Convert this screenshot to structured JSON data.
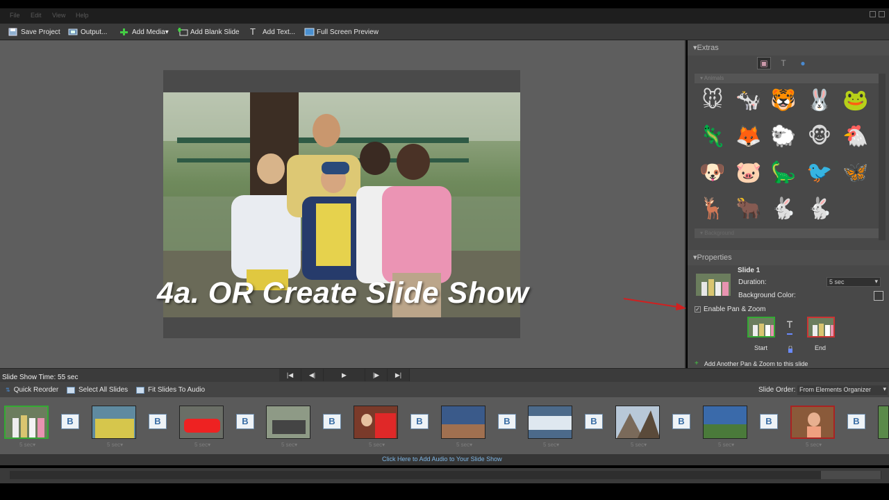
{
  "menu": {
    "file": "File",
    "edit": "Edit",
    "view": "View",
    "help": "Help"
  },
  "toolbar": {
    "save_project": "Save Project",
    "output": "Output...",
    "add_media": "Add Media▾",
    "add_blank_slide": "Add Blank Slide",
    "add_text": "Add Text...",
    "full_screen_preview": "Full Screen Preview"
  },
  "preview": {
    "overlay_title": "4a. OR Create Slide Show"
  },
  "extras": {
    "header": "▾Extras",
    "tabs": [
      "graphics-tab",
      "text-tab",
      "narration-tab"
    ],
    "animals_header": "▾ Animals",
    "background_header": "▾ Background",
    "animals": [
      "🐭",
      "🐄",
      "🐯",
      "🐰",
      "🐸",
      "🦎",
      "🦊",
      "🐑",
      "🐵",
      "🐔",
      "🐶",
      "🐷",
      "🦕",
      "🐦",
      "🦋",
      "🦌",
      "🐂",
      "🐇",
      "🐇"
    ]
  },
  "properties": {
    "header": "▾Properties",
    "slide_name": "Slide 1",
    "duration_label": "Duration:",
    "duration_value": "5 sec",
    "bgcolor_label": "Background Color:",
    "enable_pan_zoom": "Enable Pan & Zoom",
    "start_label": "Start",
    "end_label": "End",
    "add_another": "Add Another Pan & Zoom to this slide"
  },
  "transport": {
    "slide_show_time": "Slide Show Time: 55 sec"
  },
  "timeline": {
    "quick_reorder": "Quick Reorder",
    "select_all": "Select All Slides",
    "fit_to_audio": "Fit Slides To Audio",
    "slide_order_label": "Slide Order:",
    "slide_order_value": "From Elements Organizer",
    "clip_duration": "5 sec▾",
    "transition_label": "B"
  },
  "audio": {
    "link": "Click Here to Add Audio to Your Slide Show"
  },
  "colors": {
    "accent": "#3a6ea5",
    "link": "#7fb7e6",
    "selected_border": "#33aa33",
    "arrow": "#d02020"
  }
}
